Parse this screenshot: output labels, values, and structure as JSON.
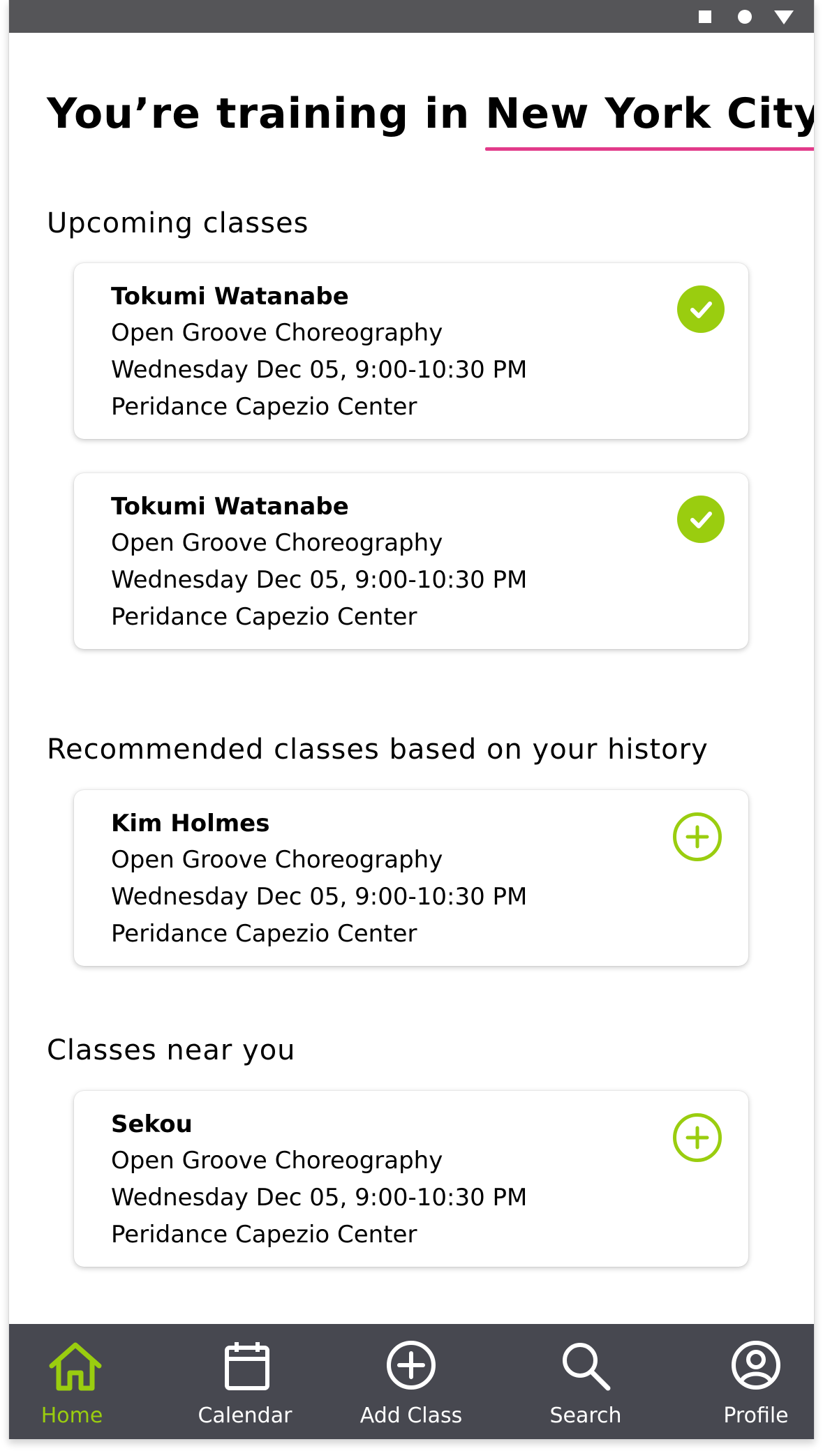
{
  "status_bar": {
    "icons": [
      "square-icon",
      "circle-icon",
      "triangle-down-icon"
    ]
  },
  "header": {
    "prefix": "You’re training in ",
    "city": "New York City"
  },
  "colors": {
    "accent": "#9acd0f",
    "underline": "#e23b8a",
    "nav_bg": "#474850",
    "status_bg": "#555558"
  },
  "sections": {
    "upcoming": {
      "title": "Upcoming classes",
      "cards": [
        {
          "name": "Tokumi Watanabe",
          "class": "Open Groove Choreography",
          "time": "Wednesday Dec 05, 9:00-10:30 PM",
          "location": "Peridance Capezio Center",
          "icon": "check-circle-icon"
        },
        {
          "name": "Tokumi Watanabe",
          "class": "Open Groove Choreography",
          "time": "Wednesday Dec 05, 9:00-10:30 PM",
          "location": "Peridance Capezio Center",
          "icon": "check-circle-icon"
        }
      ]
    },
    "recommended": {
      "title": "Recommended classes based on your history",
      "cards": [
        {
          "name": "Kim Holmes",
          "class": "Open Groove Choreography",
          "time": "Wednesday Dec 05, 9:00-10:30 PM",
          "location": "Peridance Capezio Center",
          "icon": "plus-circle-icon"
        }
      ]
    },
    "near": {
      "title": "Classes near you",
      "cards": [
        {
          "name": "Sekou",
          "class": "Open Groove Choreography",
          "time": "Wednesday Dec 05, 9:00-10:30 PM",
          "location": "Peridance Capezio Center",
          "icon": "plus-circle-icon"
        }
      ]
    }
  },
  "nav": {
    "items": [
      {
        "label": "Home",
        "icon": "home-icon",
        "active": true
      },
      {
        "label": "Calendar",
        "icon": "calendar-icon",
        "active": false
      },
      {
        "label": "Add Class",
        "icon": "add-circle-icon",
        "active": false
      },
      {
        "label": "Search",
        "icon": "search-icon",
        "active": false
      },
      {
        "label": "Profile",
        "icon": "profile-icon",
        "active": false
      }
    ]
  }
}
